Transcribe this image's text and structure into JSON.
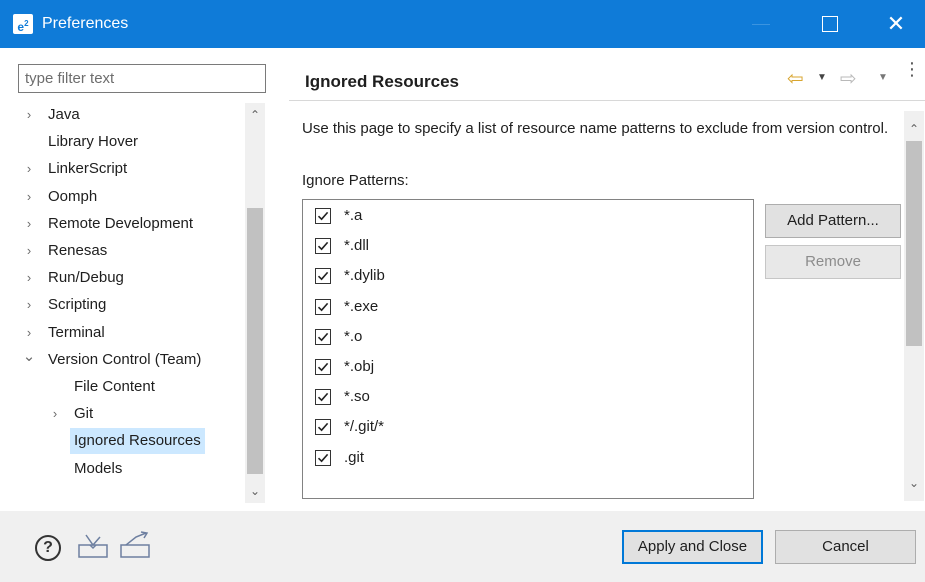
{
  "window": {
    "title": "Preferences",
    "app_icon_text": "e",
    "minimize_icon": "minimize-icon",
    "maximize_icon": "maximize-icon",
    "close_glyph": "✕",
    "accent_color": "#0f7bd8"
  },
  "left_pane": {
    "filter_placeholder": "type filter text",
    "tree": [
      {
        "label": "Java",
        "expandable": true,
        "expanded": false,
        "level": 0
      },
      {
        "label": "Library Hover",
        "expandable": false,
        "level": 0
      },
      {
        "label": "LinkerScript",
        "expandable": true,
        "expanded": false,
        "level": 0
      },
      {
        "label": "Oomph",
        "expandable": true,
        "expanded": false,
        "level": 0
      },
      {
        "label": "Remote Development",
        "expandable": true,
        "expanded": false,
        "level": 0
      },
      {
        "label": "Renesas",
        "expandable": true,
        "expanded": false,
        "level": 0
      },
      {
        "label": "Run/Debug",
        "expandable": true,
        "expanded": false,
        "level": 0
      },
      {
        "label": "Scripting",
        "expandable": true,
        "expanded": false,
        "level": 0
      },
      {
        "label": "Terminal",
        "expandable": true,
        "expanded": false,
        "level": 0
      },
      {
        "label": "Version Control (Team)",
        "expandable": true,
        "expanded": true,
        "level": 0
      },
      {
        "label": "File Content",
        "expandable": false,
        "level": 1
      },
      {
        "label": "Git",
        "expandable": true,
        "expanded": false,
        "level": 1
      },
      {
        "label": "Ignored Resources",
        "expandable": false,
        "level": 1,
        "selected": true
      },
      {
        "label": "Models",
        "expandable": false,
        "level": 1
      }
    ],
    "selection_color": "#cce8ff"
  },
  "right_pane": {
    "page_title": "Ignored Resources",
    "nav": {
      "back_icon": "back-arrow-icon",
      "forward_icon": "forward-arrow-icon",
      "menu_icon": "view-menu-icon"
    },
    "description": "Use this page to specify a list of resource name patterns to exclude from version control.",
    "patterns_label": "Ignore Patterns:",
    "patterns": [
      {
        "pattern": "*.a",
        "checked": true
      },
      {
        "pattern": "*.dll",
        "checked": true
      },
      {
        "pattern": "*.dylib",
        "checked": true
      },
      {
        "pattern": "*.exe",
        "checked": true
      },
      {
        "pattern": "*.o",
        "checked": true
      },
      {
        "pattern": "*.obj",
        "checked": true
      },
      {
        "pattern": "*.so",
        "checked": true
      },
      {
        "pattern": "*/.git/*",
        "checked": true
      },
      {
        "pattern": ".git",
        "checked": true
      }
    ],
    "add_pattern_label": "Add Pattern...",
    "remove_label": "Remove",
    "remove_enabled": false
  },
  "bottom_bar": {
    "help_icon": "help-icon",
    "import_icon": "import-preferences-icon",
    "export_icon": "export-preferences-icon",
    "apply_close_label": "Apply and Close",
    "cancel_label": "Cancel"
  }
}
